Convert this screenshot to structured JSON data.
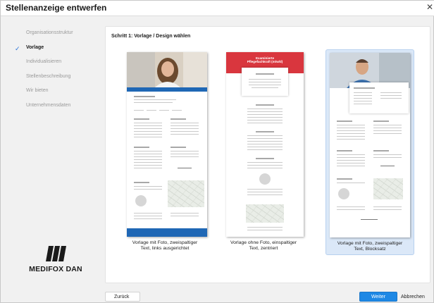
{
  "window": {
    "title": "Stellenanzeige entwerfen",
    "close_icon": "close-icon"
  },
  "sidebar": {
    "steps": [
      {
        "label": "Organisationsstruktur",
        "state": "done"
      },
      {
        "label": "Vorlage",
        "state": "active"
      },
      {
        "label": "Individualisieren",
        "state": "pending"
      },
      {
        "label": "Stellenbeschreibung",
        "state": "pending"
      },
      {
        "label": "Wir bieten",
        "state": "pending"
      },
      {
        "label": "Unternehmensdaten",
        "state": "pending"
      }
    ],
    "logo_text": "MEDIFOX DAN"
  },
  "main": {
    "heading": "Schritt 1: Vorlage / Design wählen",
    "templates": [
      {
        "caption_line1": "Vorlage mit Foto, zweispaltiger",
        "caption_line2": "Text, links ausgerichtet",
        "selected": false
      },
      {
        "caption_line1": "Vorlage ohne Foto, einspaltiger",
        "caption_line2": "Text, zentriert",
        "selected": false,
        "header_line1": "Examinierte",
        "header_line2": "Pflegefachkraft (m/w/d)"
      },
      {
        "caption_line1": "Vorlage mit Foto, zweispaltiger",
        "caption_line2": "Text, Blocksatz",
        "selected": true
      }
    ]
  },
  "footer": {
    "back_label": "Zurück",
    "next_label": "Weiter",
    "cancel_label": "Abbrechen"
  },
  "colors": {
    "accent": "#1e88e5",
    "check": "#2a73d9",
    "template_blue": "#1f67b5",
    "template_red": "#d9363e",
    "selected_bg": "#dbe8f8"
  }
}
